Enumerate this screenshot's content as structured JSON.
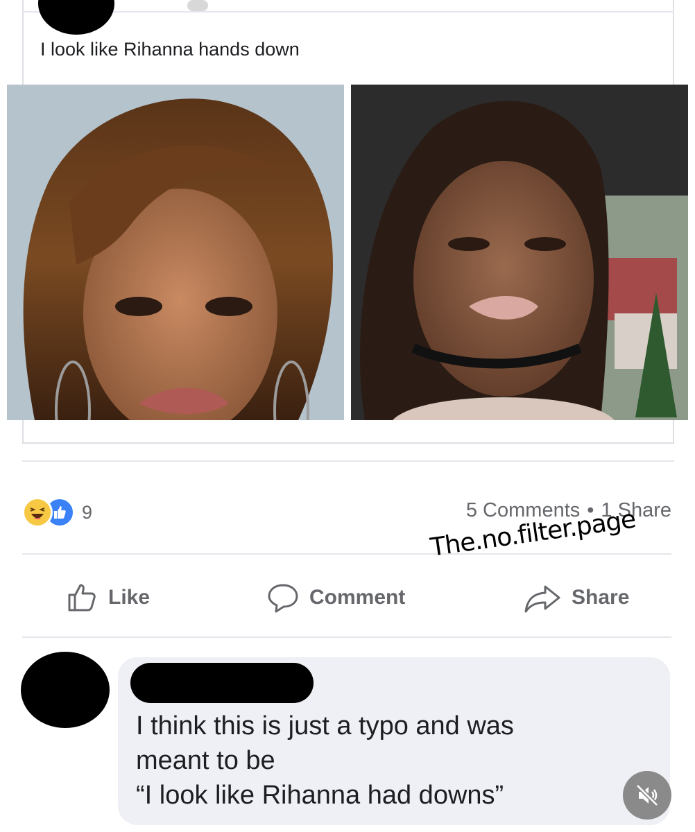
{
  "post": {
    "text": "I look like Rihanna hands down",
    "photos": [
      {
        "description_icon": "portrait-photo-icon"
      },
      {
        "description_icon": "selfie-photo-icon"
      }
    ]
  },
  "reactions": {
    "types": [
      "haha-icon",
      "like-icon"
    ],
    "count": "9"
  },
  "meta": {
    "comments": "5 Comments",
    "dot": "•",
    "shares": "1 Share"
  },
  "actions": {
    "like": "Like",
    "comment": "Comment",
    "share": "Share"
  },
  "watermark": "The.no.filter.page",
  "comment": {
    "lines": [
      "I think this is just a typo and was",
      "meant to be",
      "“I look like Rihanna had downs”"
    ]
  },
  "colors": {
    "text_primary": "#1c1e21",
    "text_secondary": "#65676b",
    "bubble": "#eff0f5",
    "like_blue": "#3b82f6",
    "haha_yellow": "#f7c844"
  },
  "icons": {
    "mute": "muted-speaker-icon"
  }
}
